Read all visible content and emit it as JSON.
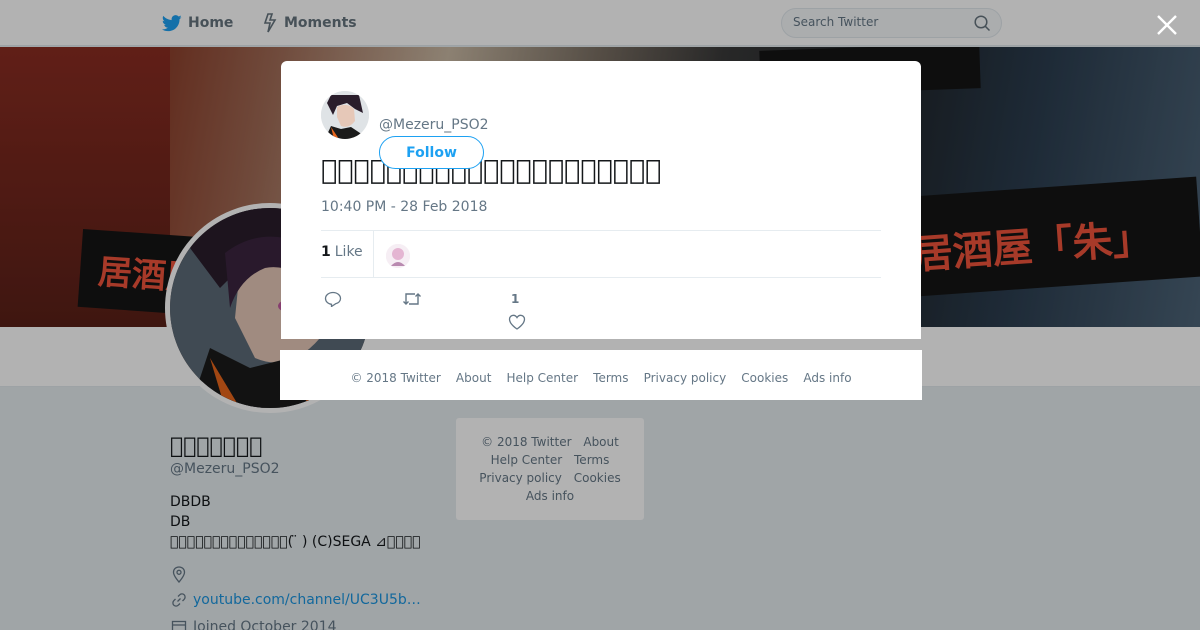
{
  "nav": {
    "home_label": "Home",
    "moments_label": "Moments",
    "search_placeholder": "Search Twitter",
    "icons": {
      "home": "twitter-bird-icon",
      "moments": "lightning-icon",
      "search": "search-icon"
    }
  },
  "banner": {
    "signs": [
      "居酒屋",
      "居酒屋「朱」",
      "居酒屋「朱」"
    ]
  },
  "profile": {
    "name": "\u0000\u0000\u0000\u0000\u0000\u0000\u0000",
    "handle": "@Mezeru_PSO2",
    "bio_lines": [
      "DBDB",
      "DB",
      "\u0000\u0000\u0000\u0000\u0000\u0000\u0000\u0000\u0000\u0000\u0000\u0000\u0000\u0000( ̈ ) (C)SEGA ⊿\u0000\u0000\u0000\u0000"
    ],
    "link": "youtube.com/channel/UC3U5b…",
    "joined": "Joined October 2014",
    "icons": {
      "location": "location-pin-icon",
      "link": "link-icon",
      "joined": "calendar-icon"
    }
  },
  "side_footer": {
    "copyright": "© 2018 Twitter",
    "about": "About",
    "help": "Help Center",
    "terms": "Terms",
    "privacy": "Privacy policy",
    "cookies": "Cookies",
    "ads": "Ads info"
  },
  "tweet": {
    "handle": "@Mezeru_PSO2",
    "follow_label": "Follow",
    "text": "\u0000\u0000\u0000\u0000\u0000\u0000\u0000\u0000\u0000\u0000\u0000\u0000\u0000\u0000\u0000\u0000\u0000\u0000\u0000\u0000\u0000",
    "timestamp": "10:40 PM - 28 Feb 2018",
    "likes_count": "1",
    "likes_label": "Like",
    "action_like_count": "1",
    "icons": {
      "reply": "reply-icon",
      "retweet": "retweet-icon",
      "like": "heart-icon",
      "close": "close-icon"
    }
  },
  "modal_footer": {
    "copyright": "© 2018 Twitter",
    "about": "About",
    "help": "Help Center",
    "terms": "Terms",
    "privacy": "Privacy policy",
    "cookies": "Cookies",
    "ads": "Ads info"
  },
  "colors": {
    "accent": "#1da1f2",
    "link": "#1b95e0",
    "muted": "#657786",
    "page_bg": "#e6ecf0",
    "sign_text": "#f0533b"
  }
}
